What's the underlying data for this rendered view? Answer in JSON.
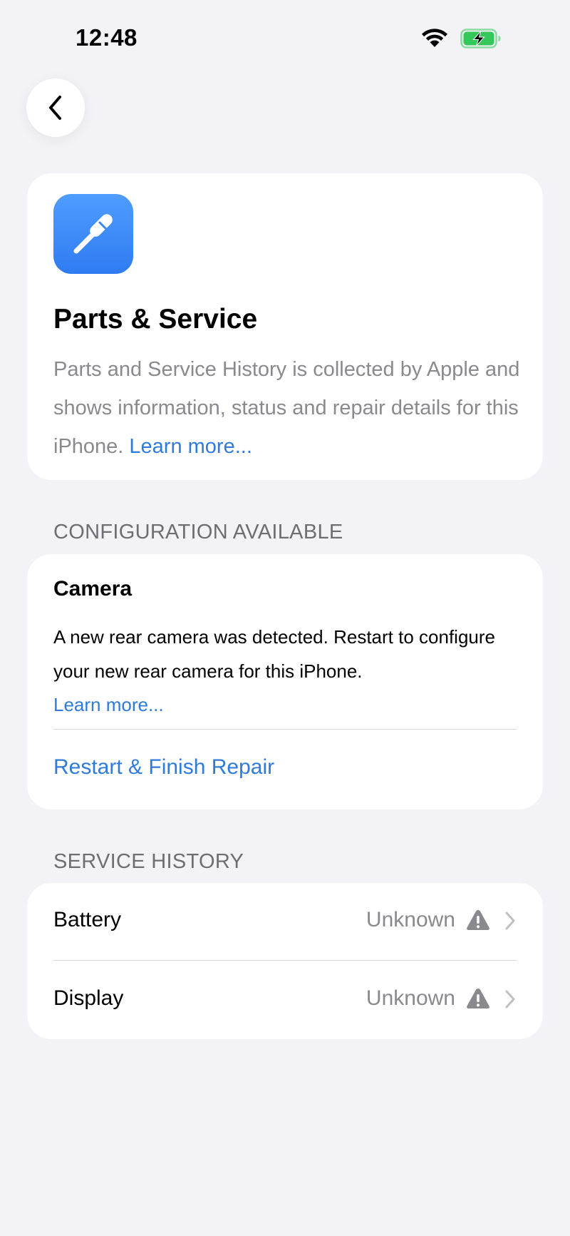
{
  "status_bar": {
    "time": "12:48",
    "battery_state": "charging",
    "battery_color": "#34C759"
  },
  "colors": {
    "background": "#F2F2F7",
    "link": "#2F7BDB",
    "secondary_text": "#8A8A8E",
    "app_icon_blue": "#3A86F7"
  },
  "intro": {
    "icon": "screwdriver-icon",
    "title": "Parts & Service",
    "description": "Parts and Service History is collected by Apple and shows information, status and repair details for this iPhone.",
    "learn_more": "Learn more..."
  },
  "configuration": {
    "header": "CONFIGURATION AVAILABLE",
    "title": "Camera",
    "description": "A new rear camera was detected. Restart to configure your new rear camera for this iPhone.",
    "learn_more": "Learn more...",
    "action": "Restart & Finish Repair"
  },
  "service_history": {
    "header": "SERVICE HISTORY",
    "items": [
      {
        "label": "Battery",
        "value": "Unknown",
        "icon": "warning-icon"
      },
      {
        "label": "Display",
        "value": "Unknown",
        "icon": "warning-icon"
      }
    ]
  }
}
